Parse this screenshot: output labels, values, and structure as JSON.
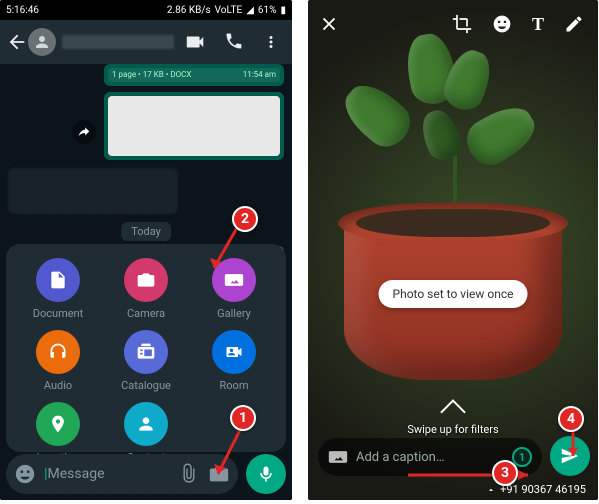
{
  "statusbar": {
    "time": "5:16:46",
    "battery": "61%",
    "net": "2.86 KB/s",
    "volte": "VoLTE"
  },
  "header": {
    "video_icon": "video-call-icon",
    "call_icon": "voice-call-icon",
    "menu_icon": "more-icon"
  },
  "chat": {
    "doc_meta_left": "1 page • 17 KB • DOCX",
    "doc_meta_right": "11:54 am",
    "date_label": "Today"
  },
  "sheet": {
    "items": [
      {
        "label": "Document",
        "color": "#5157cd",
        "icon": "document-icon"
      },
      {
        "label": "Camera",
        "color": "#d3396d",
        "icon": "camera-icon"
      },
      {
        "label": "Gallery",
        "color": "#ac44cf",
        "icon": "gallery-icon"
      },
      {
        "label": "Audio",
        "color": "#eb6c0c",
        "icon": "audio-icon"
      },
      {
        "label": "Catalogue",
        "color": "#5869d8",
        "icon": "catalogue-icon"
      },
      {
        "label": "Room",
        "color": "#0070e0",
        "icon": "room-icon"
      },
      {
        "label": "Location",
        "color": "#1fa755",
        "icon": "location-icon"
      },
      {
        "label": "Contact",
        "color": "#0eaaca",
        "icon": "contact-icon"
      }
    ]
  },
  "input": {
    "placeholder": "Message"
  },
  "editor": {
    "callout": "Photo set to view once",
    "swipe_hint": "Swipe up for filters",
    "caption_placeholder": "Add a caption…",
    "recipient": "+91 90367 46195"
  },
  "annotations": {
    "b1": "1",
    "b2": "2",
    "b3": "3",
    "b4": "4"
  }
}
